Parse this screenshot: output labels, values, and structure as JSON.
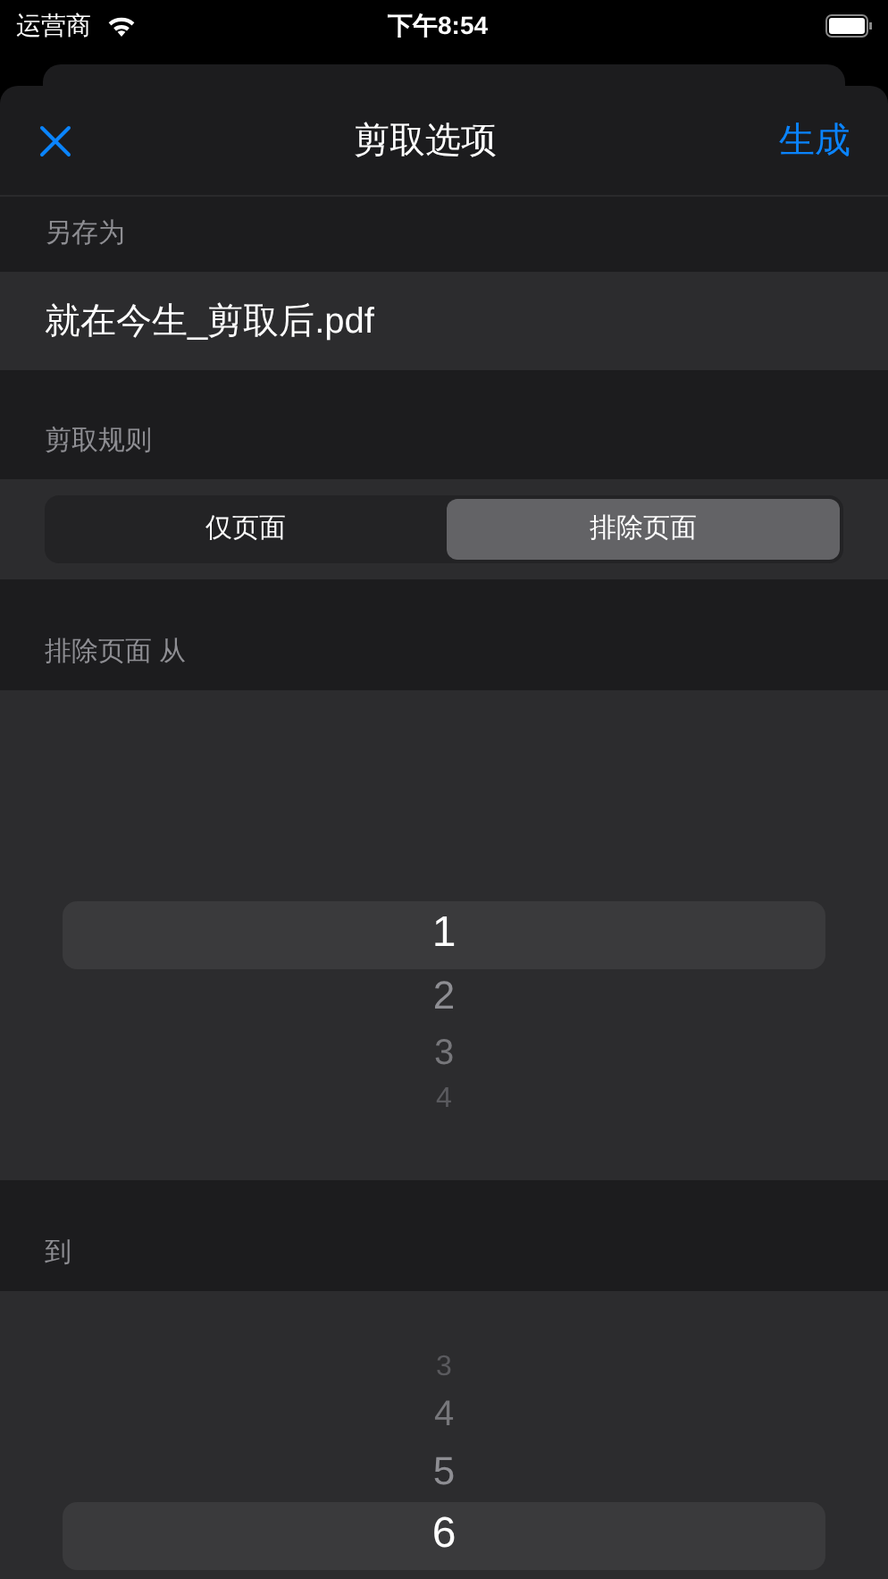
{
  "status_bar": {
    "carrier": "运营商",
    "time": "下午8:54"
  },
  "nav": {
    "title": "剪取选项",
    "action": "生成"
  },
  "save_as": {
    "label": "另存为",
    "value": "就在今生_剪取后.pdf"
  },
  "rule": {
    "label": "剪取规则",
    "segments": [
      {
        "label": "仅页面",
        "selected": false
      },
      {
        "label": "排除页面",
        "selected": true
      }
    ]
  },
  "from_picker": {
    "label": "排除页面 从",
    "items": [
      {
        "label": "1",
        "selected": true
      },
      {
        "label": "2",
        "selected": false
      },
      {
        "label": "3",
        "selected": false
      },
      {
        "label": "4",
        "selected": false
      }
    ]
  },
  "to_picker": {
    "label": "到",
    "items": [
      {
        "label": "3",
        "selected": false
      },
      {
        "label": "4",
        "selected": false
      },
      {
        "label": "5",
        "selected": false
      },
      {
        "label": "6",
        "selected": true
      }
    ]
  }
}
